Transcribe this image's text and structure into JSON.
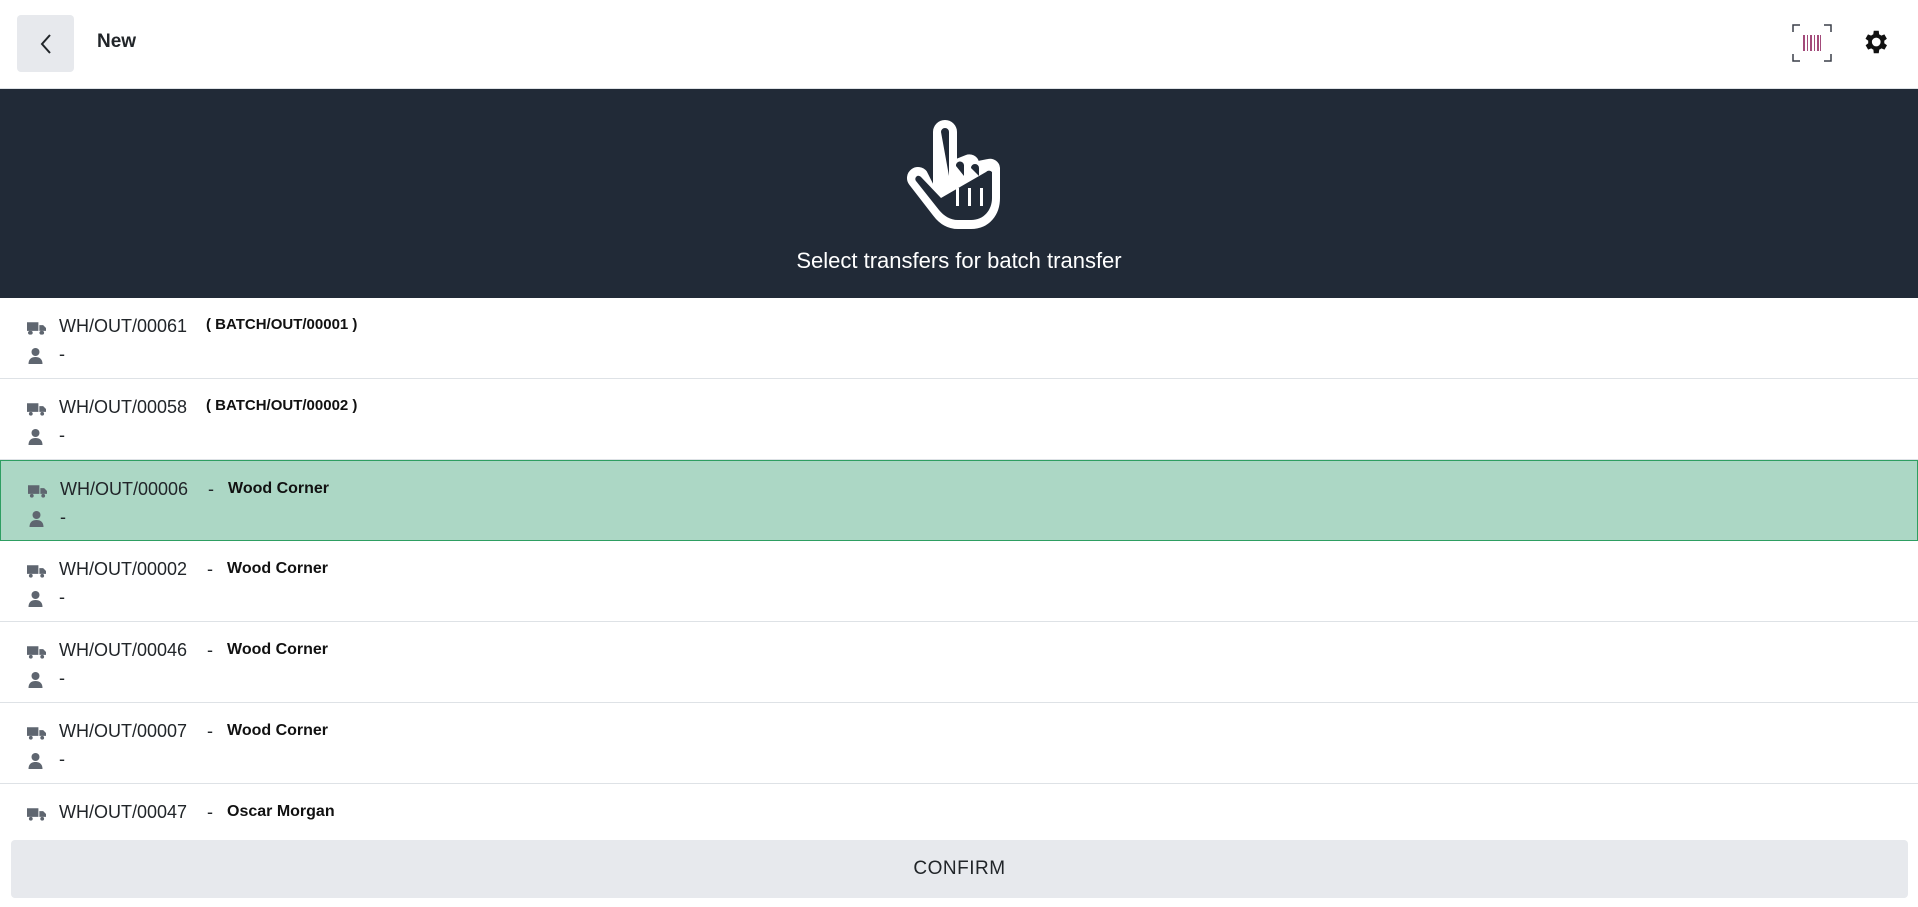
{
  "header": {
    "title": "New",
    "back_icon": "chevron-left-icon",
    "barcode_icon": "barcode-scanner-icon",
    "settings_icon": "gear-icon"
  },
  "banner": {
    "icon": "hand-pointer-icon",
    "message": "Select transfers for batch transfer"
  },
  "transfers": [
    {
      "ref": "WH/OUT/00061",
      "tag": "( BATCH/OUT/00001 )",
      "partner": "",
      "user": "-",
      "selected": false
    },
    {
      "ref": "WH/OUT/00058",
      "tag": "( BATCH/OUT/00002 )",
      "partner": "",
      "user": "-",
      "selected": false
    },
    {
      "ref": "WH/OUT/00006",
      "sep": "-",
      "tag": "",
      "partner": "Wood Corner",
      "user": "-",
      "selected": true
    },
    {
      "ref": "WH/OUT/00002",
      "sep": "-",
      "tag": "",
      "partner": "Wood Corner",
      "user": "-",
      "selected": false
    },
    {
      "ref": "WH/OUT/00046",
      "sep": "-",
      "tag": "",
      "partner": "Wood Corner",
      "user": "-",
      "selected": false
    },
    {
      "ref": "WH/OUT/00007",
      "sep": "-",
      "tag": "",
      "partner": "Wood Corner",
      "user": "-",
      "selected": false
    },
    {
      "ref": "WH/OUT/00047",
      "sep": "-",
      "tag": "",
      "partner": "Oscar Morgan",
      "user": "-",
      "selected": false
    }
  ],
  "footer": {
    "confirm_label": "CONFIRM"
  },
  "colors": {
    "banner_bg": "#212a37",
    "selected_row": "#acd7c5",
    "selected_border": "#2e9e62",
    "button_bg": "#e7e9ed"
  }
}
